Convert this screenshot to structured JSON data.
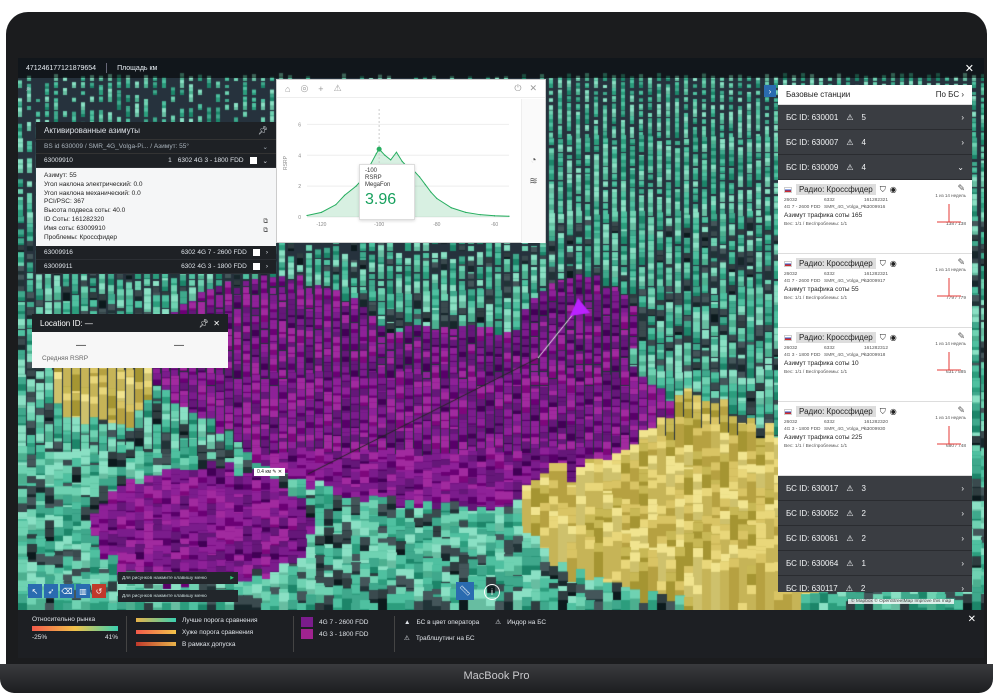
{
  "device": {
    "label": "MacBook Pro"
  },
  "topbar": {
    "id": "471246177121879654",
    "area_label": "Площадь км"
  },
  "azimuth_panel": {
    "title": "Активированные азимуты",
    "select": "BS id 630009 / SMR_4G_Volga-Pi... / Азимут: 55°",
    "rows": [
      {
        "id": "63009910",
        "count": "1",
        "band": "6302  4G  3 - 1800 FDD"
      },
      {
        "id": "63009916",
        "count": "",
        "band": "6302  4G  7 - 2600 FDD"
      },
      {
        "id": "63009911",
        "count": "",
        "band": "6302  4G  3 - 1800 FDD"
      }
    ],
    "details": [
      "Азимут: 55",
      "Угол наклона электрический: 0.0",
      "Угол наклона механический: 0.0",
      "PCI/PSC: 367",
      "Высота подвеса соты: 40.0",
      "ID Соты: 161282320",
      "Имя соты: 63009910",
      "Проблемы: Кроссфидер"
    ]
  },
  "location_panel": {
    "title": "Location ID: —",
    "val1": "—",
    "val2": "—",
    "label": "Средняя RSRP"
  },
  "chart_panel": {
    "tooltip": {
      "value_top": "-100",
      "metric": "RSRP",
      "operator": "MegaFon",
      "big": "3.96"
    },
    "ylabel": "RSRP"
  },
  "chart_data": {
    "type": "area",
    "ylabel": "RSRP",
    "xlim": [
      -125,
      -55
    ],
    "ylim": [
      0,
      7
    ],
    "yticks": [
      0,
      2,
      4,
      6
    ],
    "xticks": [
      -120,
      -100,
      -80,
      -60
    ],
    "x": [
      -125,
      -120,
      -115,
      -112,
      -108,
      -105,
      -103,
      -101,
      -100,
      -98,
      -96,
      -94,
      -92,
      -90,
      -88,
      -86,
      -84,
      -82,
      -80,
      -75,
      -70,
      -65,
      -60,
      -55
    ],
    "values": [
      0.1,
      0.3,
      0.8,
      1.4,
      2.0,
      2.6,
      3.4,
      4.1,
      4.4,
      4.0,
      3.7,
      4.2,
      3.6,
      3.2,
      3.0,
      2.6,
      2.1,
      1.6,
      1.2,
      0.6,
      0.3,
      0.15,
      0.08,
      0.05
    ]
  },
  "right_panel": {
    "title": "Базовые станции",
    "sort": "По БС",
    "stations_top": [
      {
        "label": "БС ID: 630001",
        "count": "5"
      },
      {
        "label": "БС ID: 630007",
        "count": "4"
      },
      {
        "label": "БС ID: 630009",
        "count": "4"
      }
    ],
    "cells": [
      {
        "operator": "Радио: Кроссфидер",
        "f1": "26032",
        "f2": "6332",
        "f3": "161282321",
        "f4": "4G 7 - 2600 FDD",
        "f5": "SMR_4G_Volga_Pi...",
        "f6": "63009916",
        "azimuth": "Азимут трафика соты 165",
        "foot_l": "Вес: 1/1 / Вес/проблемы: 1/1",
        "foot_r": "138 / 138",
        "days": "1 из 14 недель"
      },
      {
        "operator": "Радио: Кроссфидер",
        "f1": "26032",
        "f2": "6332",
        "f3": "161282321",
        "f4": "4G 7 - 2600 FDD",
        "f5": "SMR_4G_Volga_Pi...",
        "f6": "63009917",
        "azimuth": "Азимут трафика соты 55",
        "foot_l": "Вес: 1/1 / Вес/проблемы: 1/1",
        "foot_r": "779 / 779",
        "days": "1 из 14 недель"
      },
      {
        "operator": "Радио: Кроссфидер",
        "f1": "26032",
        "f2": "6332",
        "f3": "161282312",
        "f4": "4G 3 - 1800 FDD",
        "f5": "SMR_4G_Volga_Pi...",
        "f6": "63009918",
        "azimuth": "Азимут трафика соты 10",
        "foot_l": "Вес: 1/1 / Вес/проблемы: 1/1",
        "foot_r": "631 / 585",
        "days": "1 из 14 недель"
      },
      {
        "operator": "Радио: Кроссфидер",
        "f1": "26032",
        "f2": "6332",
        "f3": "161282320",
        "f4": "4G 3 - 1800 FDD",
        "f5": "SMR_4G_Volga_Pi...",
        "f6": "63009930",
        "azimuth": "Азимут трафика соты 225",
        "foot_l": "Вес: 1/1 / Вес/проблемы: 1/1",
        "foot_r": "680 / 748",
        "days": "1 из 14 недель"
      }
    ],
    "stations_bottom": [
      {
        "label": "БС ID: 630017",
        "count": "3"
      },
      {
        "label": "БС ID: 630052",
        "count": "2"
      },
      {
        "label": "БС ID: 630061",
        "count": "2"
      },
      {
        "label": "БС ID: 630064",
        "count": "1"
      },
      {
        "label": "БС ID: 630117",
        "count": "2"
      }
    ]
  },
  "map": {
    "distance": "0.4 км",
    "hint1": "Для рисунков нажмите клавишу меню",
    "hint2": "Для рисунков нажмите клавишу меню",
    "attribution": "© Mapbox © OpenStreetMap Improve this map"
  },
  "legend": {
    "relative_title": "Относительно рынка",
    "min": "-25%",
    "max": "41%",
    "items": [
      "Лучше порога сравнения",
      "Хуже порога сравнения",
      "В рамках допуска"
    ],
    "bands": [
      "4G 7 - 2600 FDD",
      "4G 3 - 1800 FDD"
    ],
    "markers": [
      "БС в цвет оператора",
      "Индор на БС",
      "Траблшутинг на БС"
    ]
  }
}
